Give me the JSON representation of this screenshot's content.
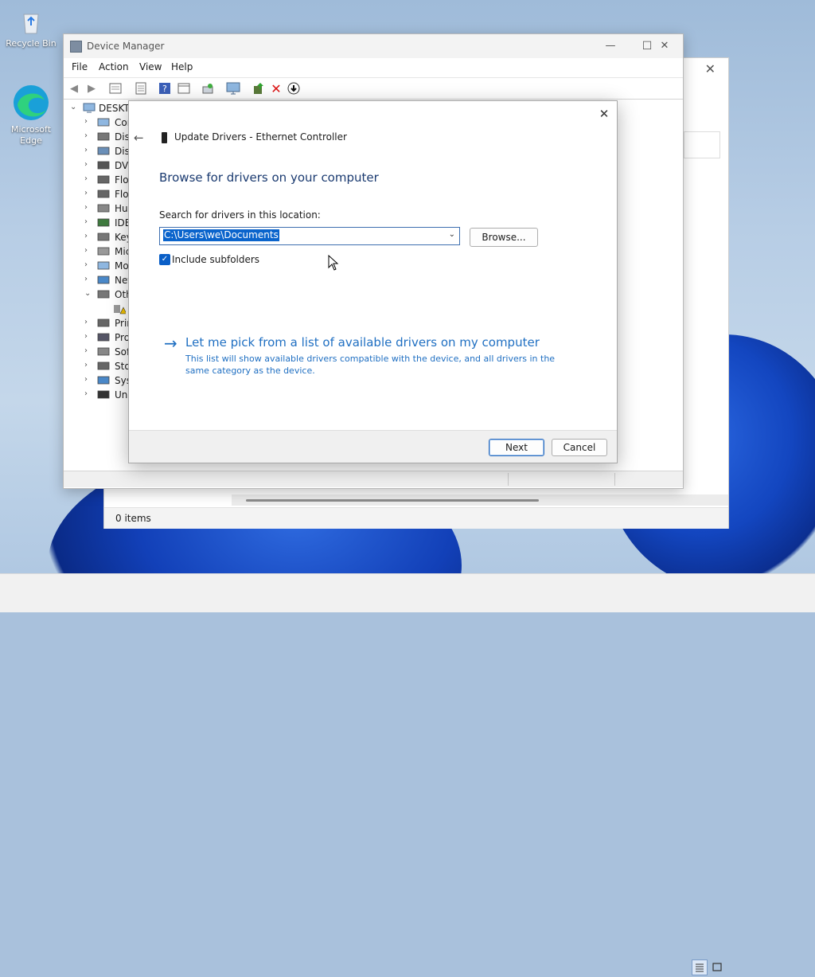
{
  "desktop": {
    "icons": [
      {
        "label": "Recycle Bin",
        "icon": "recycle-bin-icon"
      },
      {
        "label": "Microsoft Edge",
        "icon": "edge-icon"
      }
    ]
  },
  "explorer": {
    "status_text": "0 items"
  },
  "device_manager": {
    "title": "Device Manager",
    "menu": [
      "File",
      "Action",
      "View",
      "Help"
    ],
    "tree_root": "DESKTO",
    "tree_items": [
      {
        "label": "Cor",
        "expanded": false
      },
      {
        "label": "Disk",
        "expanded": false
      },
      {
        "label": "Disp",
        "expanded": false
      },
      {
        "label": "DVD",
        "expanded": false
      },
      {
        "label": "Flop",
        "expanded": false
      },
      {
        "label": "Flop",
        "expanded": false
      },
      {
        "label": "Hun",
        "expanded": false
      },
      {
        "label": "IDE",
        "expanded": false
      },
      {
        "label": "Key",
        "expanded": false
      },
      {
        "label": "Mic",
        "expanded": false
      },
      {
        "label": "Mo",
        "expanded": false
      },
      {
        "label": "Net",
        "expanded": false
      },
      {
        "label": "Oth",
        "expanded": true
      },
      {
        "label": "",
        "expanded": false
      },
      {
        "label": "Prir",
        "expanded": false
      },
      {
        "label": "Pro",
        "expanded": false
      },
      {
        "label": "Soft",
        "expanded": false
      },
      {
        "label": "Stor",
        "expanded": false
      },
      {
        "label": "Syst",
        "expanded": false
      },
      {
        "label": "Univ",
        "expanded": false
      }
    ]
  },
  "dialog": {
    "title": "Update Drivers - Ethernet Controller",
    "heading": "Browse for drivers on your computer",
    "search_label": "Search for drivers in this location:",
    "path_value": "C:\\Users\\we\\Documents",
    "browse_label": "Browse...",
    "include_subfolders_label": "Include subfolders",
    "include_subfolders_checked": true,
    "pick_title": "Let me pick from a list of available drivers on my computer",
    "pick_desc": "This list will show available drivers compatible with the device, and all drivers in the same category as the device.",
    "next_label": "Next",
    "cancel_label": "Cancel"
  },
  "colors": {
    "accent": "#0a64cc",
    "link": "#1f6fc2",
    "heading": "#1a3a70"
  }
}
